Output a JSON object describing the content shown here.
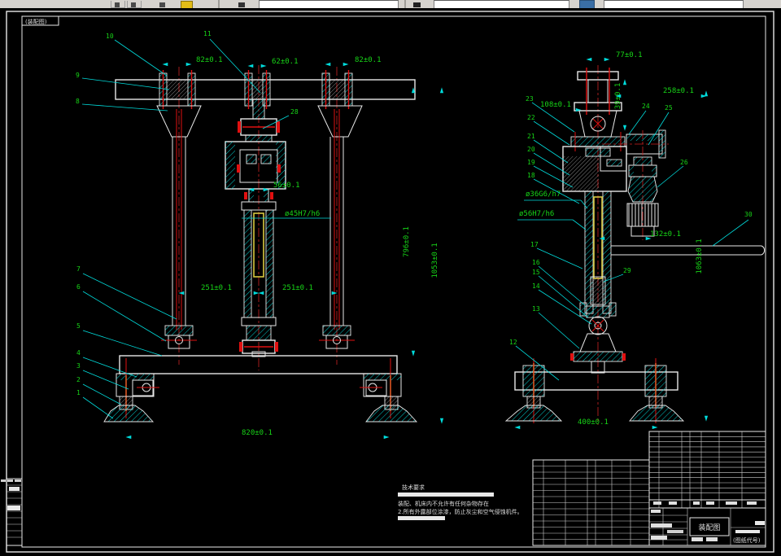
{
  "sheet": {
    "corner_label": "(装配图)",
    "notes": {
      "title": "技术要求",
      "line1": "装配、机床内不允许有任何杂物存在",
      "line2": "2.所有外露部位涂漆，防止灰尘和空气侵蚀机件。"
    },
    "title_block": {
      "drawing_title": "装配图",
      "code_label": "(图纸代号)"
    }
  },
  "front_view": {
    "dims": {
      "bolt_span_left": "82±0.1",
      "bolt_span_center": "62±0.1",
      "bolt_span_right": "82±0.1",
      "neck_width": "56±0.1",
      "cylinder_fit": "ø45H7/h6",
      "col_to_center_left": "251±0.1",
      "col_to_center_right": "251±0.1",
      "beam_to_base": "796±0.1",
      "beam_to_foot": "1053±0.1",
      "base_width": "820±0.1"
    },
    "callouts": {
      "n1": "1",
      "n2": "2",
      "n3": "3",
      "n4": "4",
      "n5": "5",
      "n6": "6",
      "n7": "7",
      "n8": "8",
      "n9": "9",
      "n10": "10",
      "n11": "11",
      "n28": "28"
    }
  },
  "side_view": {
    "dims": {
      "bracket_span": "77±0.1",
      "bracket_height": "39±0.1",
      "offset_right": "258±0.1",
      "offset_left": "108±0.1",
      "rod_fit": "ø36G6/h7",
      "bore_fit": "ø56H7/h6",
      "arm_offset": "132±0.1",
      "total_height": "1063±0.1",
      "base_width": "400±0.1"
    },
    "callouts": {
      "n12": "12",
      "n13": "13",
      "n14": "14",
      "n15": "15",
      "n16": "16",
      "n17": "17",
      "n18": "18",
      "n19": "19",
      "n20": "20",
      "n21": "21",
      "n22": "22",
      "n23": "23",
      "n24": "24",
      "n25": "25",
      "n26": "26",
      "n29": "29",
      "n30": "30"
    }
  }
}
